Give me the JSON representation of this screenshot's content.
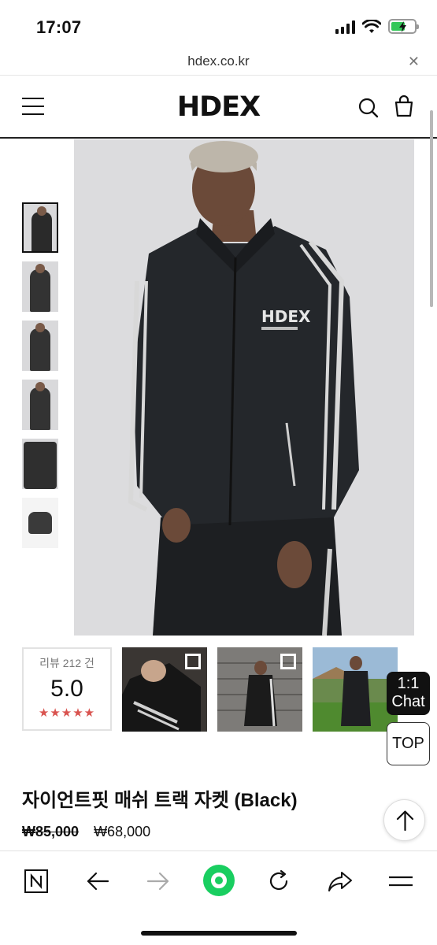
{
  "status": {
    "time": "17:07"
  },
  "browser": {
    "url": "hdex.co.kr",
    "close_icon": "close-icon"
  },
  "header": {
    "logo": "HDEX",
    "menu_icon": "hamburger-icon",
    "search_icon": "search-icon",
    "cart_icon": "shopping-bag-icon"
  },
  "gallery": {
    "thumbnails": [
      "thumbnail-1",
      "thumbnail-2",
      "thumbnail-3",
      "thumbnail-4",
      "thumbnail-5",
      "thumbnail-6"
    ],
    "selected_index": 0,
    "jacket_logo": "HDEX"
  },
  "reviews": {
    "label": "리뷰 212 건",
    "score": "5.0",
    "stars": "★★★★★"
  },
  "floating": {
    "chat_line1": "1:1",
    "chat_line2": "Chat",
    "top": "TOP"
  },
  "product": {
    "title": "자이언트핏 매쉬 트랙 자켓 (Black)",
    "original_price": "₩85,000",
    "sale_price": "₩68,000"
  },
  "toolbar": {
    "icons": [
      "naver-n-icon",
      "back-arrow-icon",
      "forward-arrow-icon",
      "green-dot-home-icon",
      "reload-icon",
      "share-icon",
      "menu-icon"
    ]
  },
  "colors": {
    "accent_green": "#19ce60",
    "star_red": "#d9534f"
  }
}
